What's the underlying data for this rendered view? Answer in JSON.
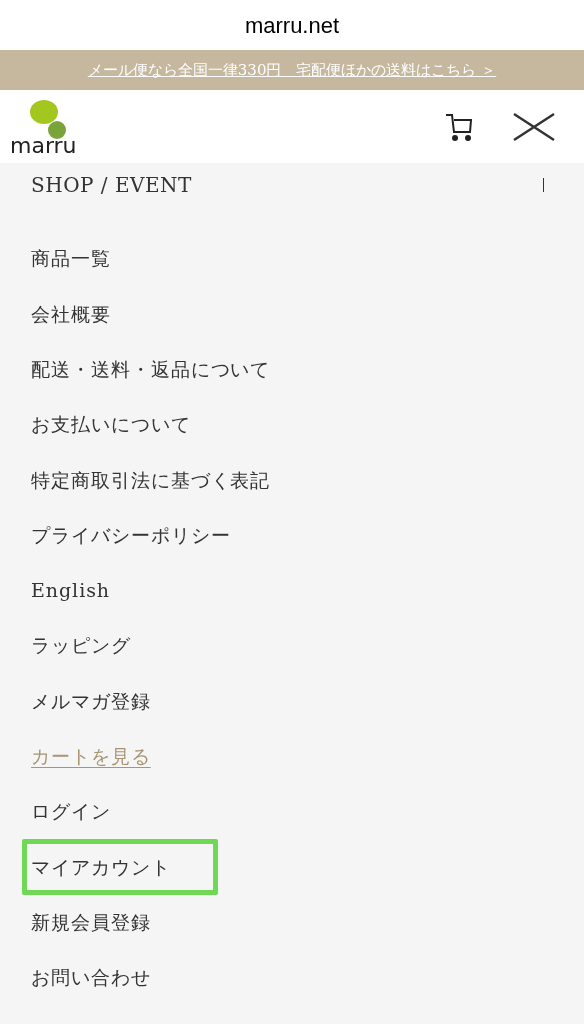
{
  "address_bar": {
    "url": "marru.net"
  },
  "banner": {
    "text": "メール便なら全国一律330円　宅配便ほかの送料はこちら ＞"
  },
  "header": {
    "logo_text": "marru"
  },
  "section": {
    "title": "SHOP / EVENT",
    "expanded": false
  },
  "menu": [
    {
      "label": "商品一覧",
      "kind": "plain",
      "highlighted": false
    },
    {
      "label": "会社概要",
      "kind": "plain",
      "highlighted": false
    },
    {
      "label": "配送・送料・返品について",
      "kind": "plain",
      "highlighted": false
    },
    {
      "label": "お支払いについて",
      "kind": "plain",
      "highlighted": false
    },
    {
      "label": "特定商取引法に基づく表記",
      "kind": "plain",
      "highlighted": false
    },
    {
      "label": "プライバシーポリシー",
      "kind": "plain",
      "highlighted": false
    },
    {
      "label": "English",
      "kind": "plain",
      "highlighted": false
    },
    {
      "label": "ラッピング",
      "kind": "plain",
      "highlighted": false
    },
    {
      "label": "メルマガ登録",
      "kind": "plain",
      "highlighted": false
    },
    {
      "label": "カートを見る",
      "kind": "link",
      "highlighted": false
    },
    {
      "label": "ログイン",
      "kind": "plain",
      "highlighted": false
    },
    {
      "label": "マイアカウント",
      "kind": "plain",
      "highlighted": true
    },
    {
      "label": "新規会員登録",
      "kind": "plain",
      "highlighted": false
    },
    {
      "label": "お問い合わせ",
      "kind": "plain",
      "highlighted": false
    }
  ]
}
